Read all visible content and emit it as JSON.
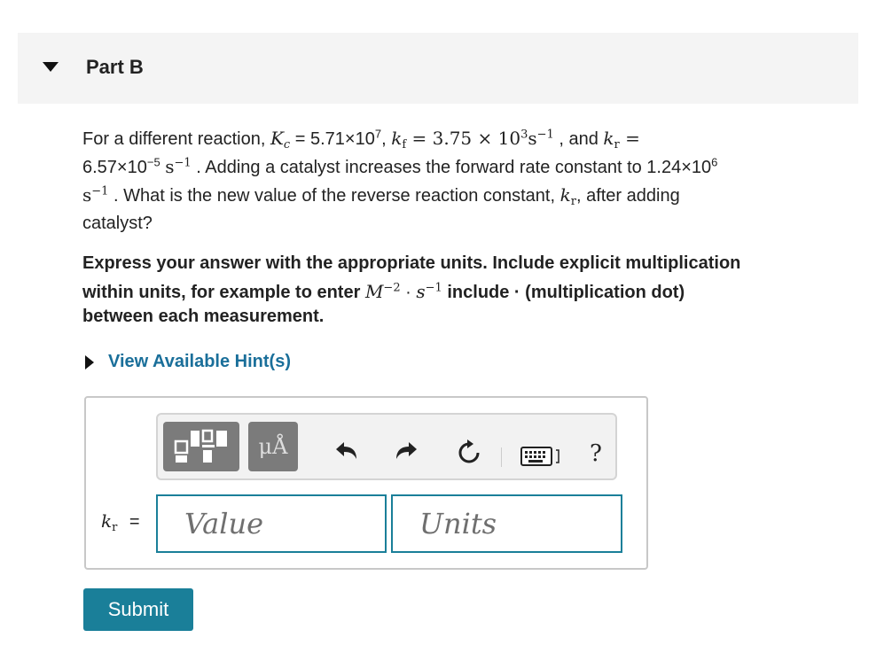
{
  "part": {
    "title": "Part B"
  },
  "question": {
    "line1_a": "For a different reaction,",
    "Kc_sym": "K",
    "Kc_sub": "c",
    "Kc_val": " = 5.71×10",
    "Kc_exp": "7",
    "comma1": ",",
    "kf_sym": "k",
    "kf_sub": "f",
    "kf_val": " = 3.75 × 10",
    "kf_exp": "3",
    "kf_unit": "s",
    "kf_unit_exp": "−1",
    "and_text": ", and",
    "kr_sym": "k",
    "kr_sub": "r",
    "equals": " =",
    "kr_val": "6.57×10",
    "kr_exp": "−5",
    "kr_unit": "s",
    "kr_unit_exp": "−1",
    "line2_rest": ". Adding a catalyst increases the forward rate constant to 1.24×10",
    "new_kf_exp": "6",
    "line3_unit": "s",
    "line3_unit_exp": "−1",
    "line3_a": ". What is the new value of the reverse reaction constant,",
    "line3_kr_sym": "k",
    "line3_kr_sub": "r",
    "line3_b": ", after adding",
    "line4": "catalyst?"
  },
  "instructions": {
    "line1": "Express your answer with the appropriate units. Include explicit multiplication",
    "line2_a": "within units, for example to enter",
    "ex_M": "M",
    "ex_M_exp": "−2",
    "ex_dot": " · ",
    "ex_s": "s",
    "ex_s_exp": "−1",
    "line2_b": " include · (multiplication dot)",
    "line3": "between each measurement."
  },
  "hint": {
    "label": "View Available Hint(s)"
  },
  "toolbar": {
    "mu_label": "μÅ",
    "icons": [
      "templates-icon",
      "units-mu-angstrom-icon",
      "undo-icon",
      "redo-icon",
      "reset-icon",
      "keyboard-icon",
      "help-icon"
    ],
    "help_label": "?"
  },
  "answer": {
    "var_sym": "k",
    "var_sub": "r",
    "equals": "=",
    "value_placeholder": "Value",
    "units_placeholder": "Units"
  },
  "submit": {
    "label": "Submit"
  },
  "colors": {
    "accent": "#1a7f99",
    "link": "#1a6f9a",
    "toolbar_button": "#7b7b7b"
  }
}
